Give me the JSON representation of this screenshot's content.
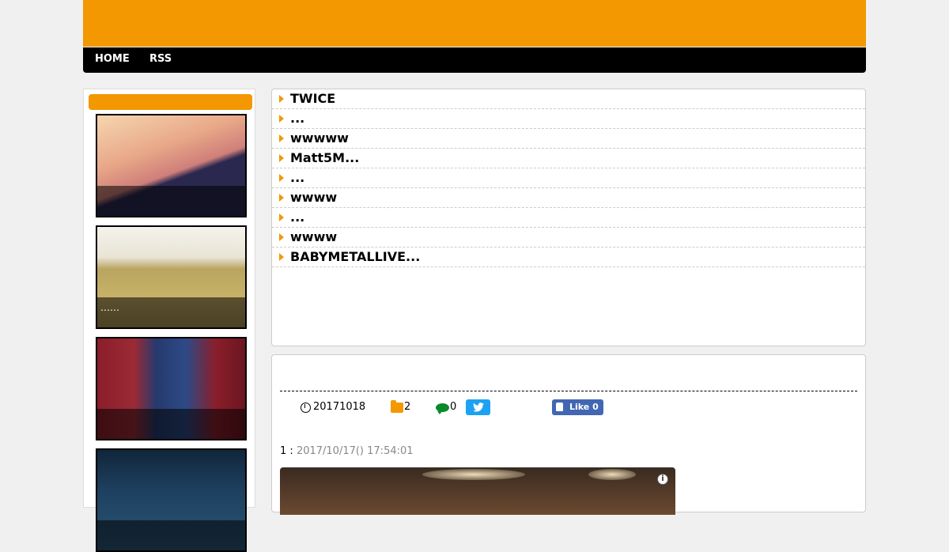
{
  "colors": {
    "accent": "#f39800",
    "nav_bg": "#000000",
    "twitter": "#1da1f2",
    "facebook": "#4267b2"
  },
  "nav": {
    "items": [
      {
        "label": "HOME"
      },
      {
        "label": "RSS"
      }
    ]
  },
  "sidebar": {
    "heading": "",
    "thumbnails": [
      {
        "caption": ""
      },
      {
        "caption": "……"
      },
      {
        "caption": ""
      },
      {
        "caption": ""
      }
    ]
  },
  "list": {
    "items": [
      {
        "title": "TWICE"
      },
      {
        "title": "..."
      },
      {
        "title": "wwwww"
      },
      {
        "title": "Matt5M..."
      },
      {
        "title": "..."
      },
      {
        "title": "wwww"
      },
      {
        "title": "..."
      },
      {
        "title": "wwww"
      },
      {
        "title": "BABYMETALLIVE..."
      }
    ]
  },
  "article": {
    "date": "20171018",
    "category_count": "2",
    "comment_count": "0",
    "twitter_icon": "twitter-bird-icon",
    "facebook_label": "Like 0",
    "post_number": "1",
    "post_separator": " : ",
    "post_timestamp": "2017/10/17() 17:54:01"
  }
}
